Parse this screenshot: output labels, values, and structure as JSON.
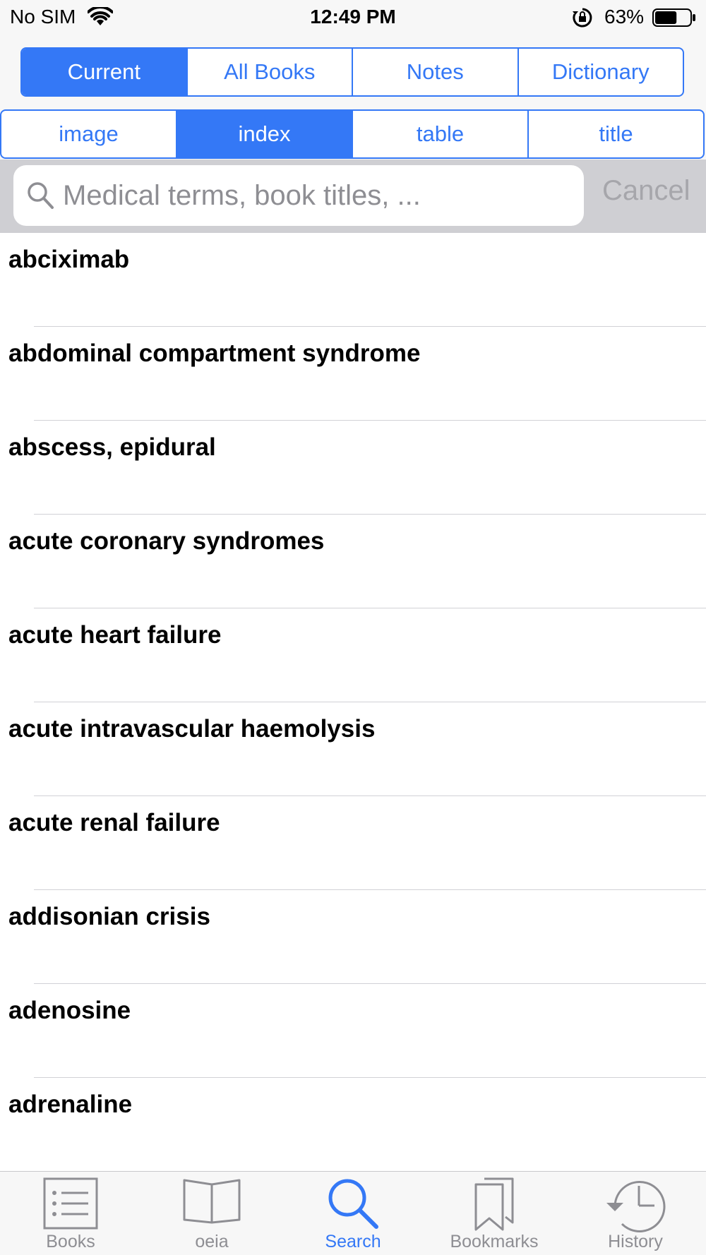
{
  "status_bar": {
    "carrier": "No SIM",
    "time": "12:49 PM",
    "battery_percent": "63%",
    "battery_level": 0.63
  },
  "scope_tabs": [
    {
      "label": "Current",
      "selected": true
    },
    {
      "label": "All Books",
      "selected": false
    },
    {
      "label": "Notes",
      "selected": false
    },
    {
      "label": "Dictionary",
      "selected": false
    }
  ],
  "type_tabs": [
    {
      "label": "image",
      "selected": false
    },
    {
      "label": "index",
      "selected": true
    },
    {
      "label": "table",
      "selected": false
    },
    {
      "label": "title",
      "selected": false
    }
  ],
  "search": {
    "placeholder": "Medical terms, book titles, ...",
    "value": "",
    "cancel_label": "Cancel"
  },
  "results": [
    "abciximab",
    "abdominal compartment syndrome",
    "abscess, epidural",
    "acute coronary syndromes",
    "acute heart failure",
    "acute intravascular haemolysis",
    "acute renal failure",
    "addisonian crisis",
    "adenosine",
    "adrenaline"
  ],
  "tab_bar": [
    {
      "label": "Books",
      "icon": "list-icon",
      "selected": false
    },
    {
      "label": "oeia",
      "icon": "open-book-icon",
      "selected": false
    },
    {
      "label": "Search",
      "icon": "search-icon",
      "selected": true
    },
    {
      "label": "Bookmarks",
      "icon": "bookmarks-icon",
      "selected": false
    },
    {
      "label": "History",
      "icon": "history-clock-icon",
      "selected": false
    }
  ],
  "colors": {
    "accent": "#3478f6",
    "inactive": "#8e8e93",
    "search_bg": "#cfcfd3"
  }
}
